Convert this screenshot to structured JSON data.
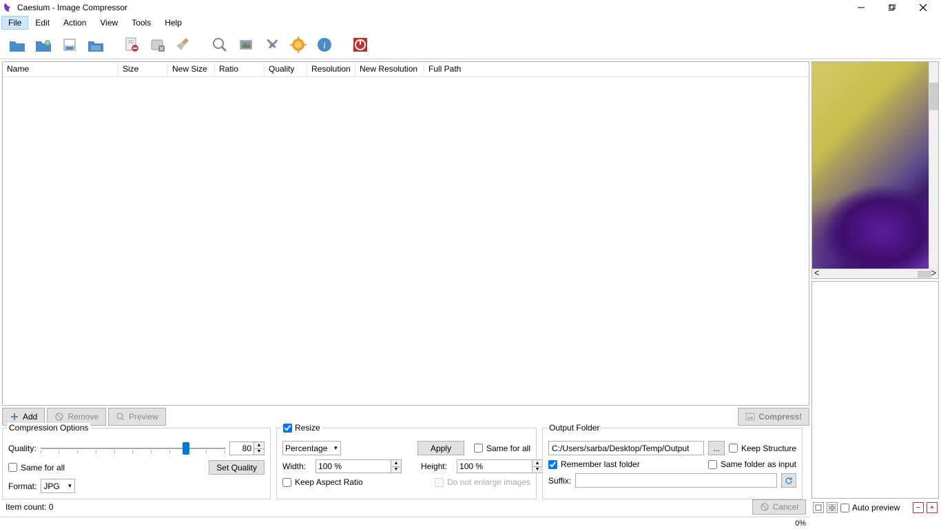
{
  "app": {
    "title": "Caesium - Image Compressor"
  },
  "menu": {
    "items": [
      "File",
      "Edit",
      "Action",
      "View",
      "Tools",
      "Help"
    ],
    "active_index": 0
  },
  "table": {
    "columns": [
      "Name",
      "Size",
      "New Size",
      "Ratio",
      "Quality",
      "Resolution",
      "New Resolution",
      "Full Path"
    ]
  },
  "btnbar": {
    "add": "Add",
    "remove": "Remove",
    "preview": "Preview",
    "compress": "Compress!"
  },
  "compress": {
    "group_title": "Compression Options",
    "quality_label": "Quality:",
    "quality_value": "80",
    "set_quality": "Set Quality",
    "same_for_all": "Same for all",
    "format_label": "Format:",
    "format_value": "JPG"
  },
  "resize": {
    "group_title": "Resize",
    "mode": "Percentage",
    "apply": "Apply",
    "same_for_all": "Same for all",
    "width_label": "Width:",
    "width_value": "100 %",
    "height_label": "Height:",
    "height_value": "100 %",
    "keep_aspect": "Keep Aspect Ratio",
    "no_enlarge": "Do not enlarge images"
  },
  "output": {
    "group_title": "Output Folder",
    "path": "C:/Users/sarba/Desktop/Temp/Output",
    "browse": "...",
    "keep_structure": "Keep Structure",
    "remember": "Remember last folder",
    "same_as_input": "Same folder as input",
    "suffix_label": "Suffix:",
    "suffix_value": ""
  },
  "bottom": {
    "item_count": "Item count: 0",
    "cancel": "Cancel"
  },
  "preview": {
    "auto_preview": "Auto preview"
  },
  "status": {
    "progress": "0%"
  }
}
